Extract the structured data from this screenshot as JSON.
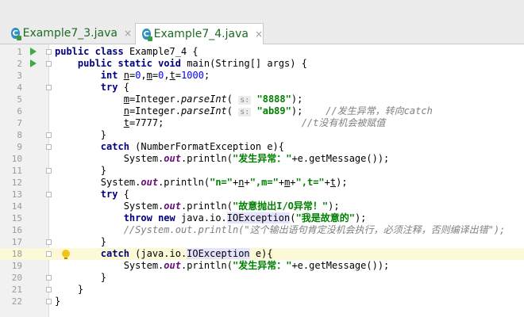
{
  "tabs": [
    {
      "label": "Example7_3.java",
      "active": false
    },
    {
      "label": "Example7_4.java",
      "active": true
    }
  ],
  "tab_close": "×",
  "file_icon_letter": "C",
  "hint_s": "s:",
  "words": {
    "public": "public",
    "class": "class",
    "static": "static",
    "void": "void",
    "int": "int",
    "try": "try",
    "catch": "catch",
    "throw": "throw",
    "new": "new",
    "brace_open": "{",
    "brace_close": "}"
  },
  "code": {
    "class_name": " Example7_4 ",
    "main_sig": " main(String[] args) ",
    "n": "n",
    "m": "m",
    "t": "t",
    "eq": "=",
    "comma": ",",
    "semi": ";",
    "zero": "0",
    "thousand": "1000",
    "seven": "7777",
    "int_parse": "Integer.",
    "parseInt": "parseInt",
    "paren_open": "(",
    "paren_open_sp": "( ",
    "paren_close_semi": ");",
    "s8888": "\"8888\"",
    "sab89": "\"ab89\"",
    "comment1": "//发生异常，转向catch",
    "comment2": "//t没有机会被赋值",
    "nfe": " (NumberFormatException e)",
    "sysout": "System.",
    "out": "out",
    "println": ".println(",
    "plus": "+",
    "get_msg": "+e.getMessage());",
    "s_exc": "\"发生异常：\"",
    "sn": "\"n=\"",
    "sm": "\",m=\"",
    "st": "\",t=\"",
    "s_io": "\"故意抛出I/O异常！\"",
    "io_pkg": " java.io.",
    "ioexc": "IOException",
    "s_me": "\"我是故意的\"",
    "comment3": "//System.out.println(\"这个输出语句肯定没机会执行，必须注释，否则编译出错\");",
    "catch_io_a": " (java.io.",
    "catch_io_b": " e)"
  },
  "line_numbers": [
    "1",
    "2",
    "3",
    "4",
    "5",
    "6",
    "7",
    "8",
    "9",
    "10",
    "11",
    "12",
    "13",
    "14",
    "15",
    "16",
    "17",
    "18",
    "19",
    "20",
    "21",
    "22"
  ],
  "colors": {
    "keyword": "#000080",
    "number": "#0000ff",
    "string": "#008000",
    "comment": "#808080",
    "field": "#660e7a",
    "current_line": "#fcfad6"
  }
}
